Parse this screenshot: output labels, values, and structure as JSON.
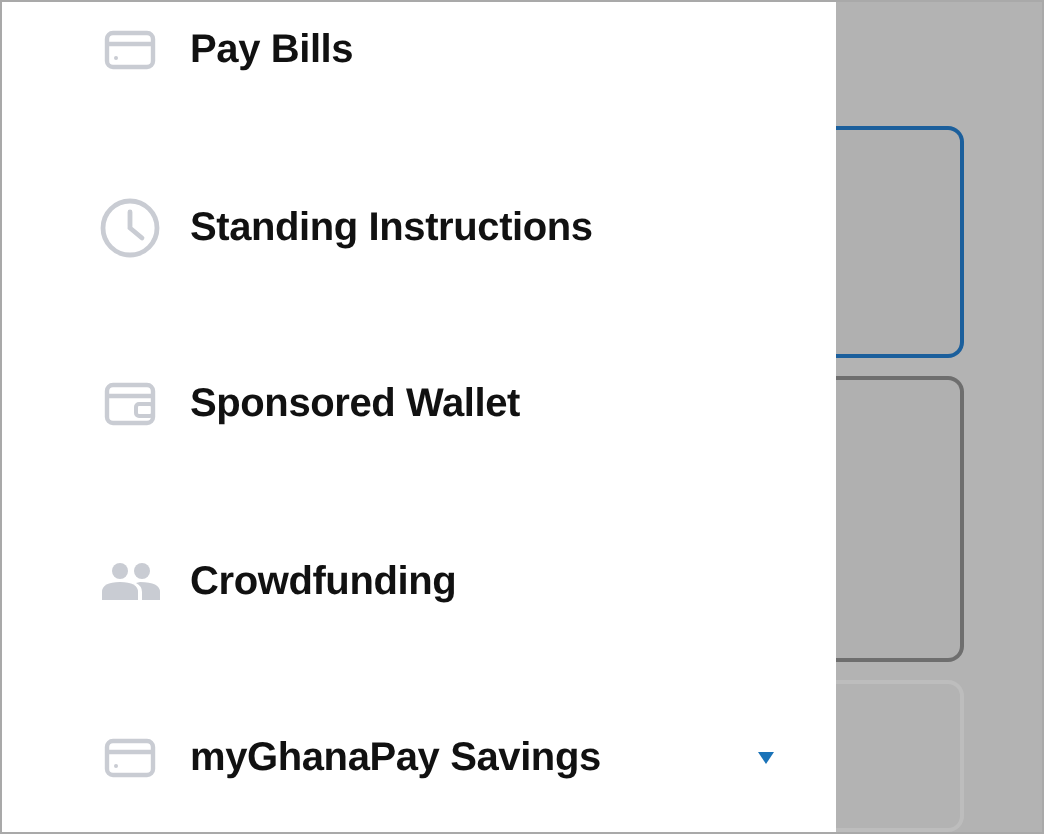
{
  "drawer": {
    "items": [
      {
        "label": "Pay Bills",
        "kind": "link"
      },
      {
        "label": "Standing Instructions",
        "kind": "link"
      },
      {
        "label": "Sponsored Wallet",
        "kind": "link"
      },
      {
        "label": "Crowdfunding",
        "kind": "link"
      },
      {
        "label": "myGhanaPay Savings",
        "kind": "dropdown"
      }
    ]
  }
}
